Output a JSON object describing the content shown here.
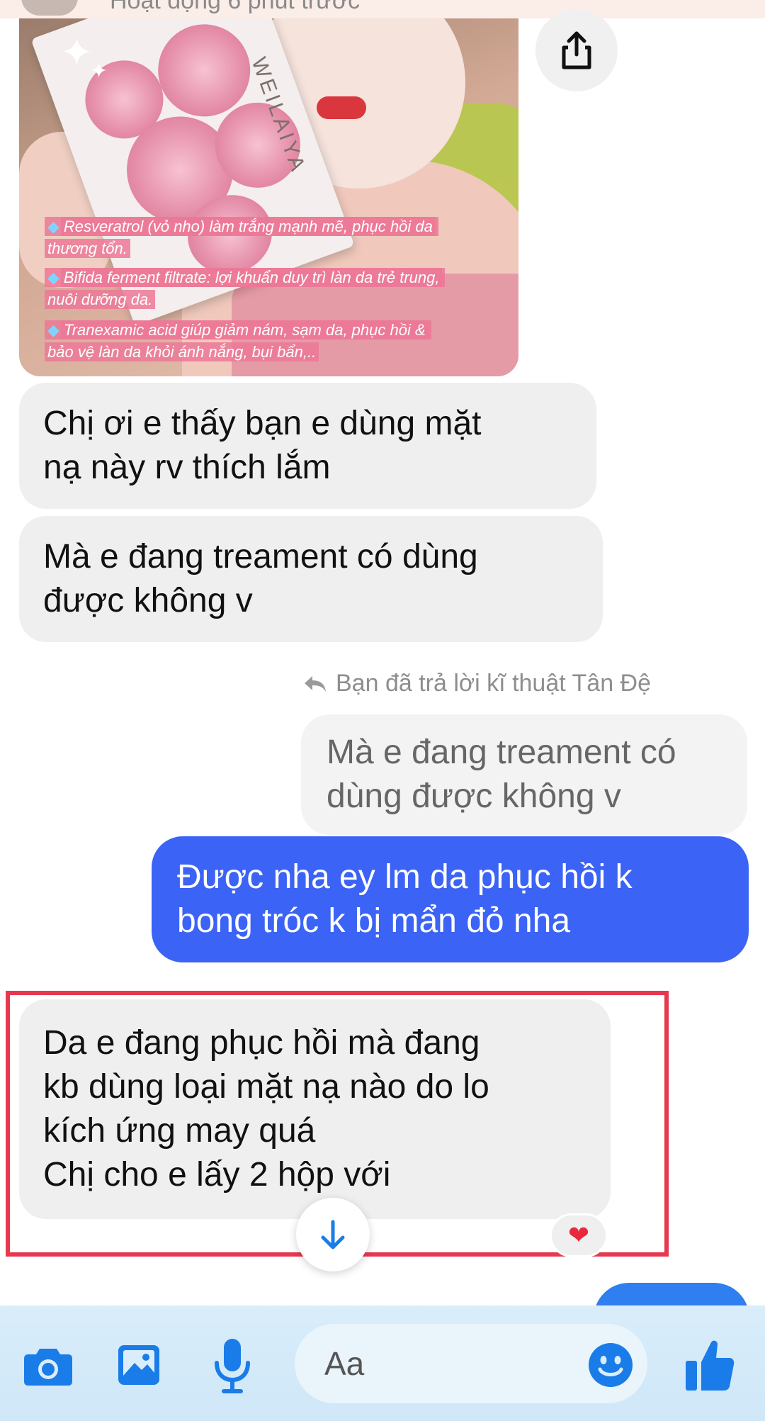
{
  "header": {
    "status_text": "Hoạt động 6 phút trước"
  },
  "shared_image": {
    "brand": "WEILAIYA",
    "captions": [
      "Resveratrol (vỏ nho) làm trắng  mạnh mẽ, phục hồi da",
      "thương tổn.",
      "Bifida ferment filtrate: lợi khuẩn duy trì làn da trẻ trung,",
      "nuôi dưỡng da.",
      "Tranexamic acid giúp giảm nám, sạm da, phục hồi &",
      "bảo vệ làn da khỏi ánh nắng, bụi bẩn,.."
    ]
  },
  "messages": {
    "m1_line1": "Chị ơi e thấy bạn e dùng mặt",
    "m1_line2": "nạ này rv thích lắm",
    "m2_line1": "Mà e đang treament có dùng",
    "m2_line2": "được không v",
    "reply_note": "Bạn đã trả lời kĩ thuật Tân Đệ",
    "quoted_line1": "Mà e đang treament có",
    "quoted_line2": "dùng được không v",
    "reply_line1": "Được nha ey lm da phục hồi k",
    "reply_line2": "bong tróc k bị mẩn đỏ nha",
    "m3_line1": "Da e đang phục hồi mà đang",
    "m3_line2": "kb dùng loại mặt nạ nào do lo",
    "m3_line3": "kích ứng may quá",
    "m3_line4": "Chị cho e lấy 2 hộp với",
    "reaction": "❤"
  },
  "composer": {
    "placeholder": "Aa",
    "icons": [
      "camera-icon",
      "image-icon",
      "microphone-icon",
      "emoji-icon",
      "thumbs-up-icon"
    ]
  },
  "colors": {
    "accent_blue": "#3b63f5",
    "icon_blue": "#1a7ce8",
    "highlight_red": "#e8384f",
    "incoming_bubble": "#efefef"
  }
}
